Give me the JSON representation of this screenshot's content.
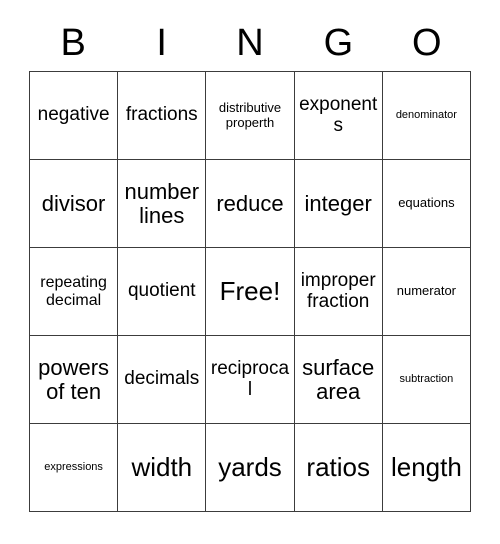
{
  "header": {
    "letters": [
      "B",
      "I",
      "N",
      "G",
      "O"
    ]
  },
  "grid": {
    "columns": 5,
    "rows": 5,
    "border_color": "#3c3c3c",
    "background_color": "#ffffff",
    "text_color": "#000000",
    "cells": [
      {
        "text": "negative",
        "size": "lg"
      },
      {
        "text": "fractions",
        "size": "lg"
      },
      {
        "text": "distributive\nproperth",
        "size": "sm"
      },
      {
        "text": "exponents",
        "size": "lg"
      },
      {
        "text": "denominator",
        "size": "xs"
      },
      {
        "text": "divisor",
        "size": "xl"
      },
      {
        "text": "number\nlines",
        "size": "xl"
      },
      {
        "text": "reduce",
        "size": "xl"
      },
      {
        "text": "integer",
        "size": "xl"
      },
      {
        "text": "equations",
        "size": "sm"
      },
      {
        "text": "repeating\ndecimal",
        "size": "md"
      },
      {
        "text": "quotient",
        "size": "lg"
      },
      {
        "text": "Free!",
        "size": "xxl"
      },
      {
        "text": "improper\nfraction",
        "size": "lg"
      },
      {
        "text": "numerator",
        "size": "sm"
      },
      {
        "text": "powers\nof ten",
        "size": "xl"
      },
      {
        "text": "decimals",
        "size": "lg"
      },
      {
        "text": "reciprocal",
        "size": "lg"
      },
      {
        "text": "surface\narea",
        "size": "xl"
      },
      {
        "text": "subtraction",
        "size": "xs"
      },
      {
        "text": "expressions",
        "size": "xs"
      },
      {
        "text": "width",
        "size": "xxl"
      },
      {
        "text": "yards",
        "size": "xxl"
      },
      {
        "text": "ratios",
        "size": "xxl"
      },
      {
        "text": "length",
        "size": "xxl"
      }
    ]
  }
}
